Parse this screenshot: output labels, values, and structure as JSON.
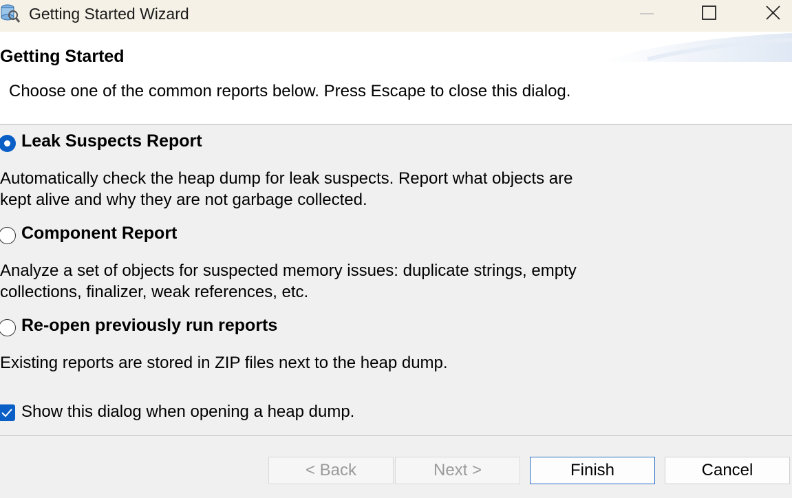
{
  "window": {
    "title": "Getting Started Wizard"
  },
  "header": {
    "title": "Getting Started",
    "description": "Choose one of the common reports below. Press Escape to close this dialog."
  },
  "options": [
    {
      "label": "Leak Suspects Report",
      "selected": true,
      "description_lines": [
        "Automatically check the heap dump for leak suspects. Report what objects are",
        "kept alive and why they are not garbage collected."
      ]
    },
    {
      "label": "Component Report",
      "selected": false,
      "description_lines": [
        "Analyze a set of objects for suspected memory issues: duplicate strings, empty",
        "collections, finalizer, weak references, etc."
      ]
    },
    {
      "label": "Re-open previously run reports",
      "selected": false,
      "description_lines": [
        "Existing reports are stored in ZIP files next to the heap dump."
      ]
    }
  ],
  "show_dialog": {
    "label": "Show this dialog when opening a heap dump.",
    "checked": true
  },
  "buttons": {
    "back": "< Back",
    "next": "Next >",
    "finish": "Finish",
    "cancel": "Cancel"
  },
  "colors": {
    "accent": "#0a5fc7",
    "titlebar": "#f5f1e6",
    "dialog_bg": "#f0f0f0"
  }
}
